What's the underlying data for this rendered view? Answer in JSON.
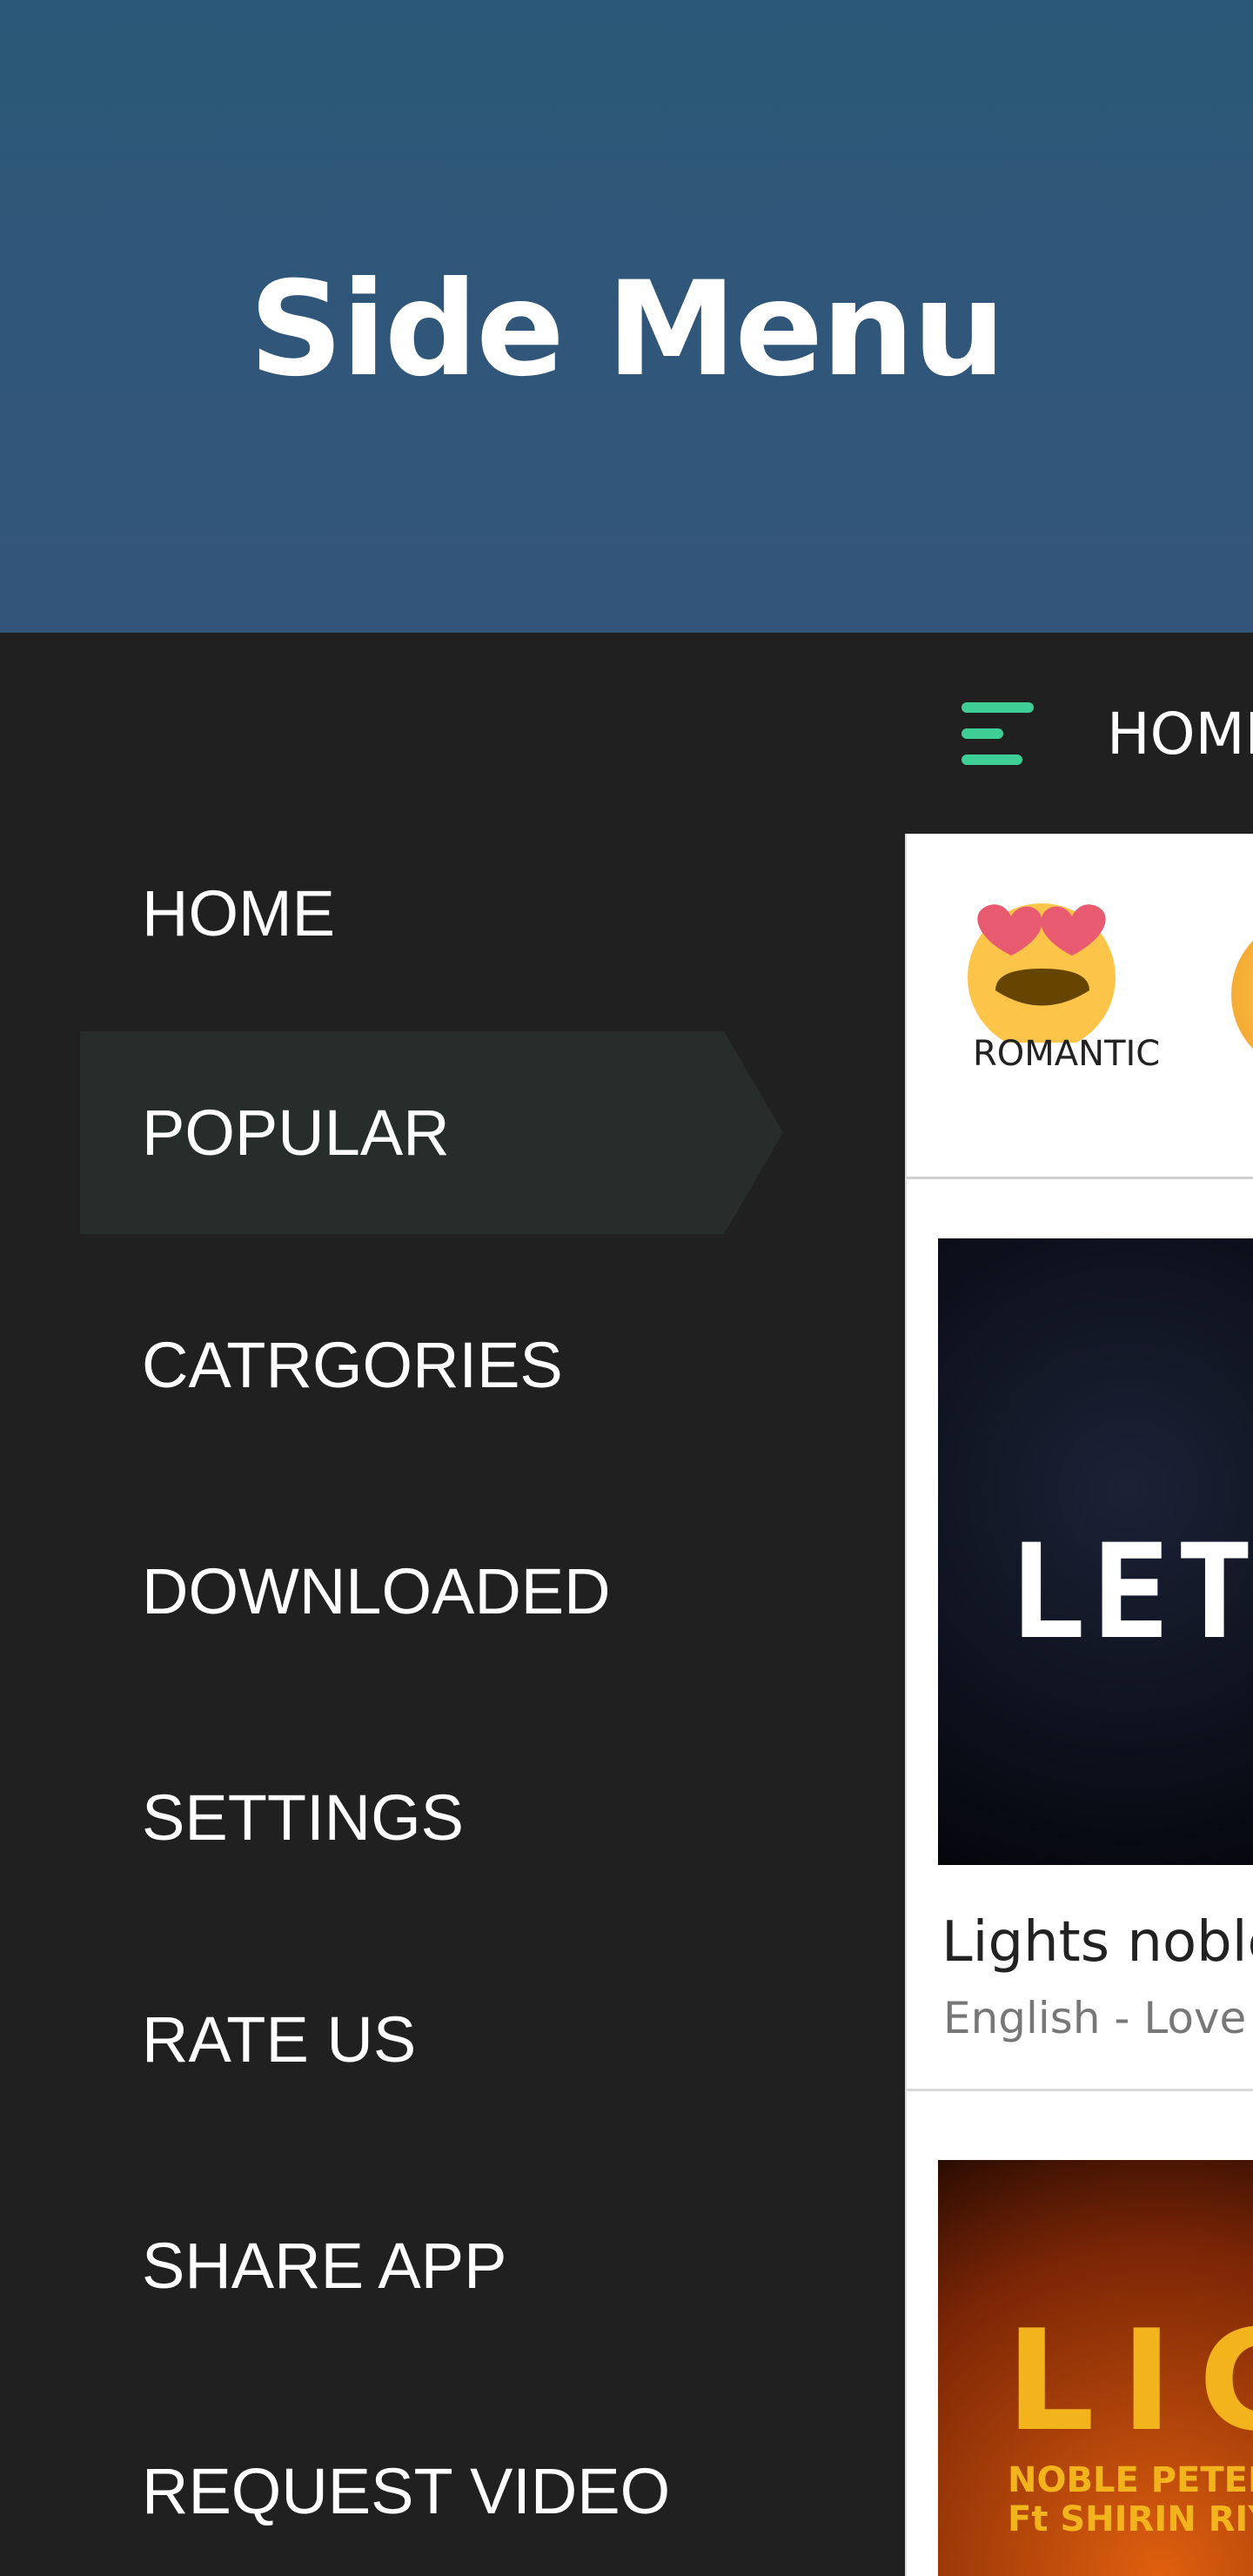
{
  "header": {
    "title": "Side Menu"
  },
  "menu": {
    "selected": "POPULAR",
    "items": [
      {
        "label": "HOME"
      },
      {
        "label": "POPULAR"
      },
      {
        "label": "CATRGORIES"
      },
      {
        "label": "DOWNLOADED"
      },
      {
        "label": "SETTINGS"
      },
      {
        "label": "RATE US"
      },
      {
        "label": "SHARE APP"
      },
      {
        "label": "REQUEST VIDEO"
      }
    ]
  },
  "toolbar": {
    "title": "HOME",
    "menu_icon": "hamburger-icon",
    "accent": "#3ecf97"
  },
  "categories": [
    {
      "label": "ROMANTIC",
      "icon": "heart-eyes-emoji"
    }
  ],
  "videos": [
    {
      "title": "Lights noble",
      "subtitle": "English - Love F",
      "thumb_text": "LET"
    },
    {
      "thumb_text": "LIG",
      "thumb_caption1": "NOBLE PETER",
      "thumb_caption2": "Ft SHIRIN RIYAZU"
    }
  ]
}
